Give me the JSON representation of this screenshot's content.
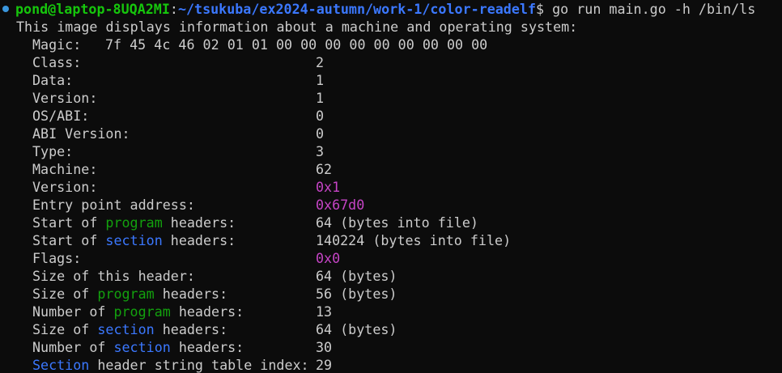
{
  "prompt": {
    "user_host": "pond@laptop-8UQA2MI",
    "separator": ":",
    "path": "~/tsukuba/ex2024-autumn/work-1/color-readelf",
    "symbol": "$",
    "command": " go run main.go -h /bin/ls"
  },
  "intro": "This image displays information about a machine and operating system:",
  "magic": {
    "label": "Magic:",
    "value": "7f 45 4c 46 02 01 01 00 00 00 00 00 00 00 00 00"
  },
  "fields": {
    "class": {
      "label": "Class:",
      "value": "2"
    },
    "data": {
      "label": "Data:",
      "value": "1"
    },
    "version": {
      "label": "Version:",
      "value": "1"
    },
    "osabi": {
      "label": "OS/ABI:",
      "value": "0"
    },
    "abi_version": {
      "label": "ABI Version:",
      "value": "0"
    },
    "type": {
      "label": "Type:",
      "value": "3"
    },
    "machine": {
      "label": "Machine:",
      "value": "62"
    },
    "version2": {
      "label": "Version:",
      "value": "0x1"
    },
    "entry": {
      "label": "Entry point address:",
      "value": "0x67d0"
    },
    "start_program": {
      "pre": "Start of ",
      "hl": "program",
      "post": " headers:",
      "value": "64 (bytes into file)"
    },
    "start_section": {
      "pre": "Start of ",
      "hl": "section",
      "post": " headers:",
      "value": "140224 (bytes into file)"
    },
    "flags": {
      "label": "Flags:",
      "value": "0x0"
    },
    "size_header": {
      "label": "Size of this header:",
      "value": "64 (bytes)"
    },
    "size_program": {
      "pre": "Size of ",
      "hl": "program",
      "post": " headers:",
      "value": "56 (bytes)"
    },
    "num_program": {
      "pre": "Number of ",
      "hl": "program",
      "post": " headers:",
      "value": "13"
    },
    "size_section": {
      "pre": "Size of ",
      "hl": "section",
      "post": " headers:",
      "value": "64 (bytes)"
    },
    "num_section": {
      "pre": "Number of ",
      "hl": "section",
      "post": " headers:",
      "value": "30"
    },
    "shstrndx": {
      "pre": "",
      "hl": "Section",
      "post": " header string table index:",
      "value": "29"
    }
  },
  "colors": {
    "background": "#0c0c0c",
    "text": "#cccccc",
    "user": "#16c60c",
    "path": "#3b78ff",
    "program_highlight": "#13a10e",
    "section_highlight": "#3b78ff",
    "hex_value": "#c544c5"
  }
}
